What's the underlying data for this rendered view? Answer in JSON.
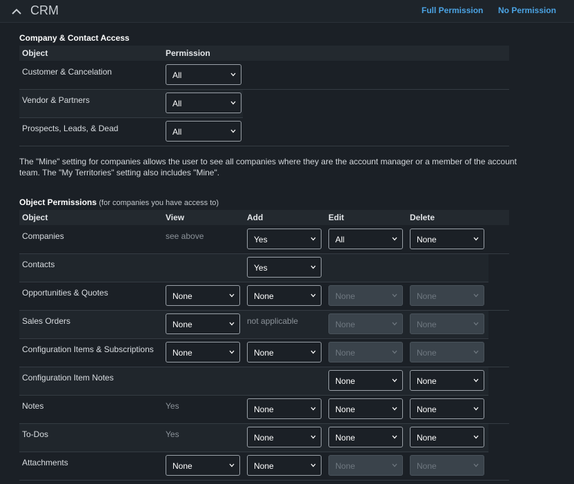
{
  "header": {
    "title": "CRM",
    "full_permission": "Full Permission",
    "no_permission": "No Permission"
  },
  "company_access": {
    "heading": "Company & Contact Access",
    "col_object": "Object",
    "col_permission": "Permission",
    "rows": [
      {
        "label": "Customer & Cancelation",
        "permission": "All"
      },
      {
        "label": "Vendor & Partners",
        "permission": "All"
      },
      {
        "label": "Prospects, Leads, & Dead",
        "permission": "All"
      }
    ]
  },
  "info_text": "The \"Mine\" setting for companies allows the user to see all companies where they are the account manager or a member of the account team. The \"My Territories\" setting also includes \"Mine\".",
  "object_permissions": {
    "heading": "Object Permissions",
    "note": "(for companies you have access to)",
    "col_object": "Object",
    "col_view": "View",
    "col_add": "Add",
    "col_edit": "Edit",
    "col_delete": "Delete",
    "rows": [
      {
        "label": "Companies",
        "view_text": "see above",
        "add": "Yes",
        "edit": "All",
        "delete": "None"
      },
      {
        "label": "Contacts",
        "add": "Yes"
      },
      {
        "label": "Opportunities & Quotes",
        "view": "None",
        "add": "None",
        "edit": "None",
        "delete": "None"
      },
      {
        "label": "Sales Orders",
        "view": "None",
        "add_text": "not applicable",
        "edit": "None",
        "delete": "None"
      },
      {
        "label": "Configuration Items & Subscriptions",
        "view": "None",
        "add": "None",
        "edit": "None",
        "delete": "None"
      },
      {
        "label": "Configuration Item Notes",
        "edit": "None",
        "delete": "None"
      },
      {
        "label": "Notes",
        "view_text": "Yes",
        "add": "None",
        "edit": "None",
        "delete": "None"
      },
      {
        "label": "To-Dos",
        "view_text": "Yes",
        "add": "None",
        "edit": "None",
        "delete": "None"
      },
      {
        "label": "Attachments",
        "view": "None",
        "add": "None",
        "edit": "None",
        "delete": "None"
      }
    ]
  }
}
